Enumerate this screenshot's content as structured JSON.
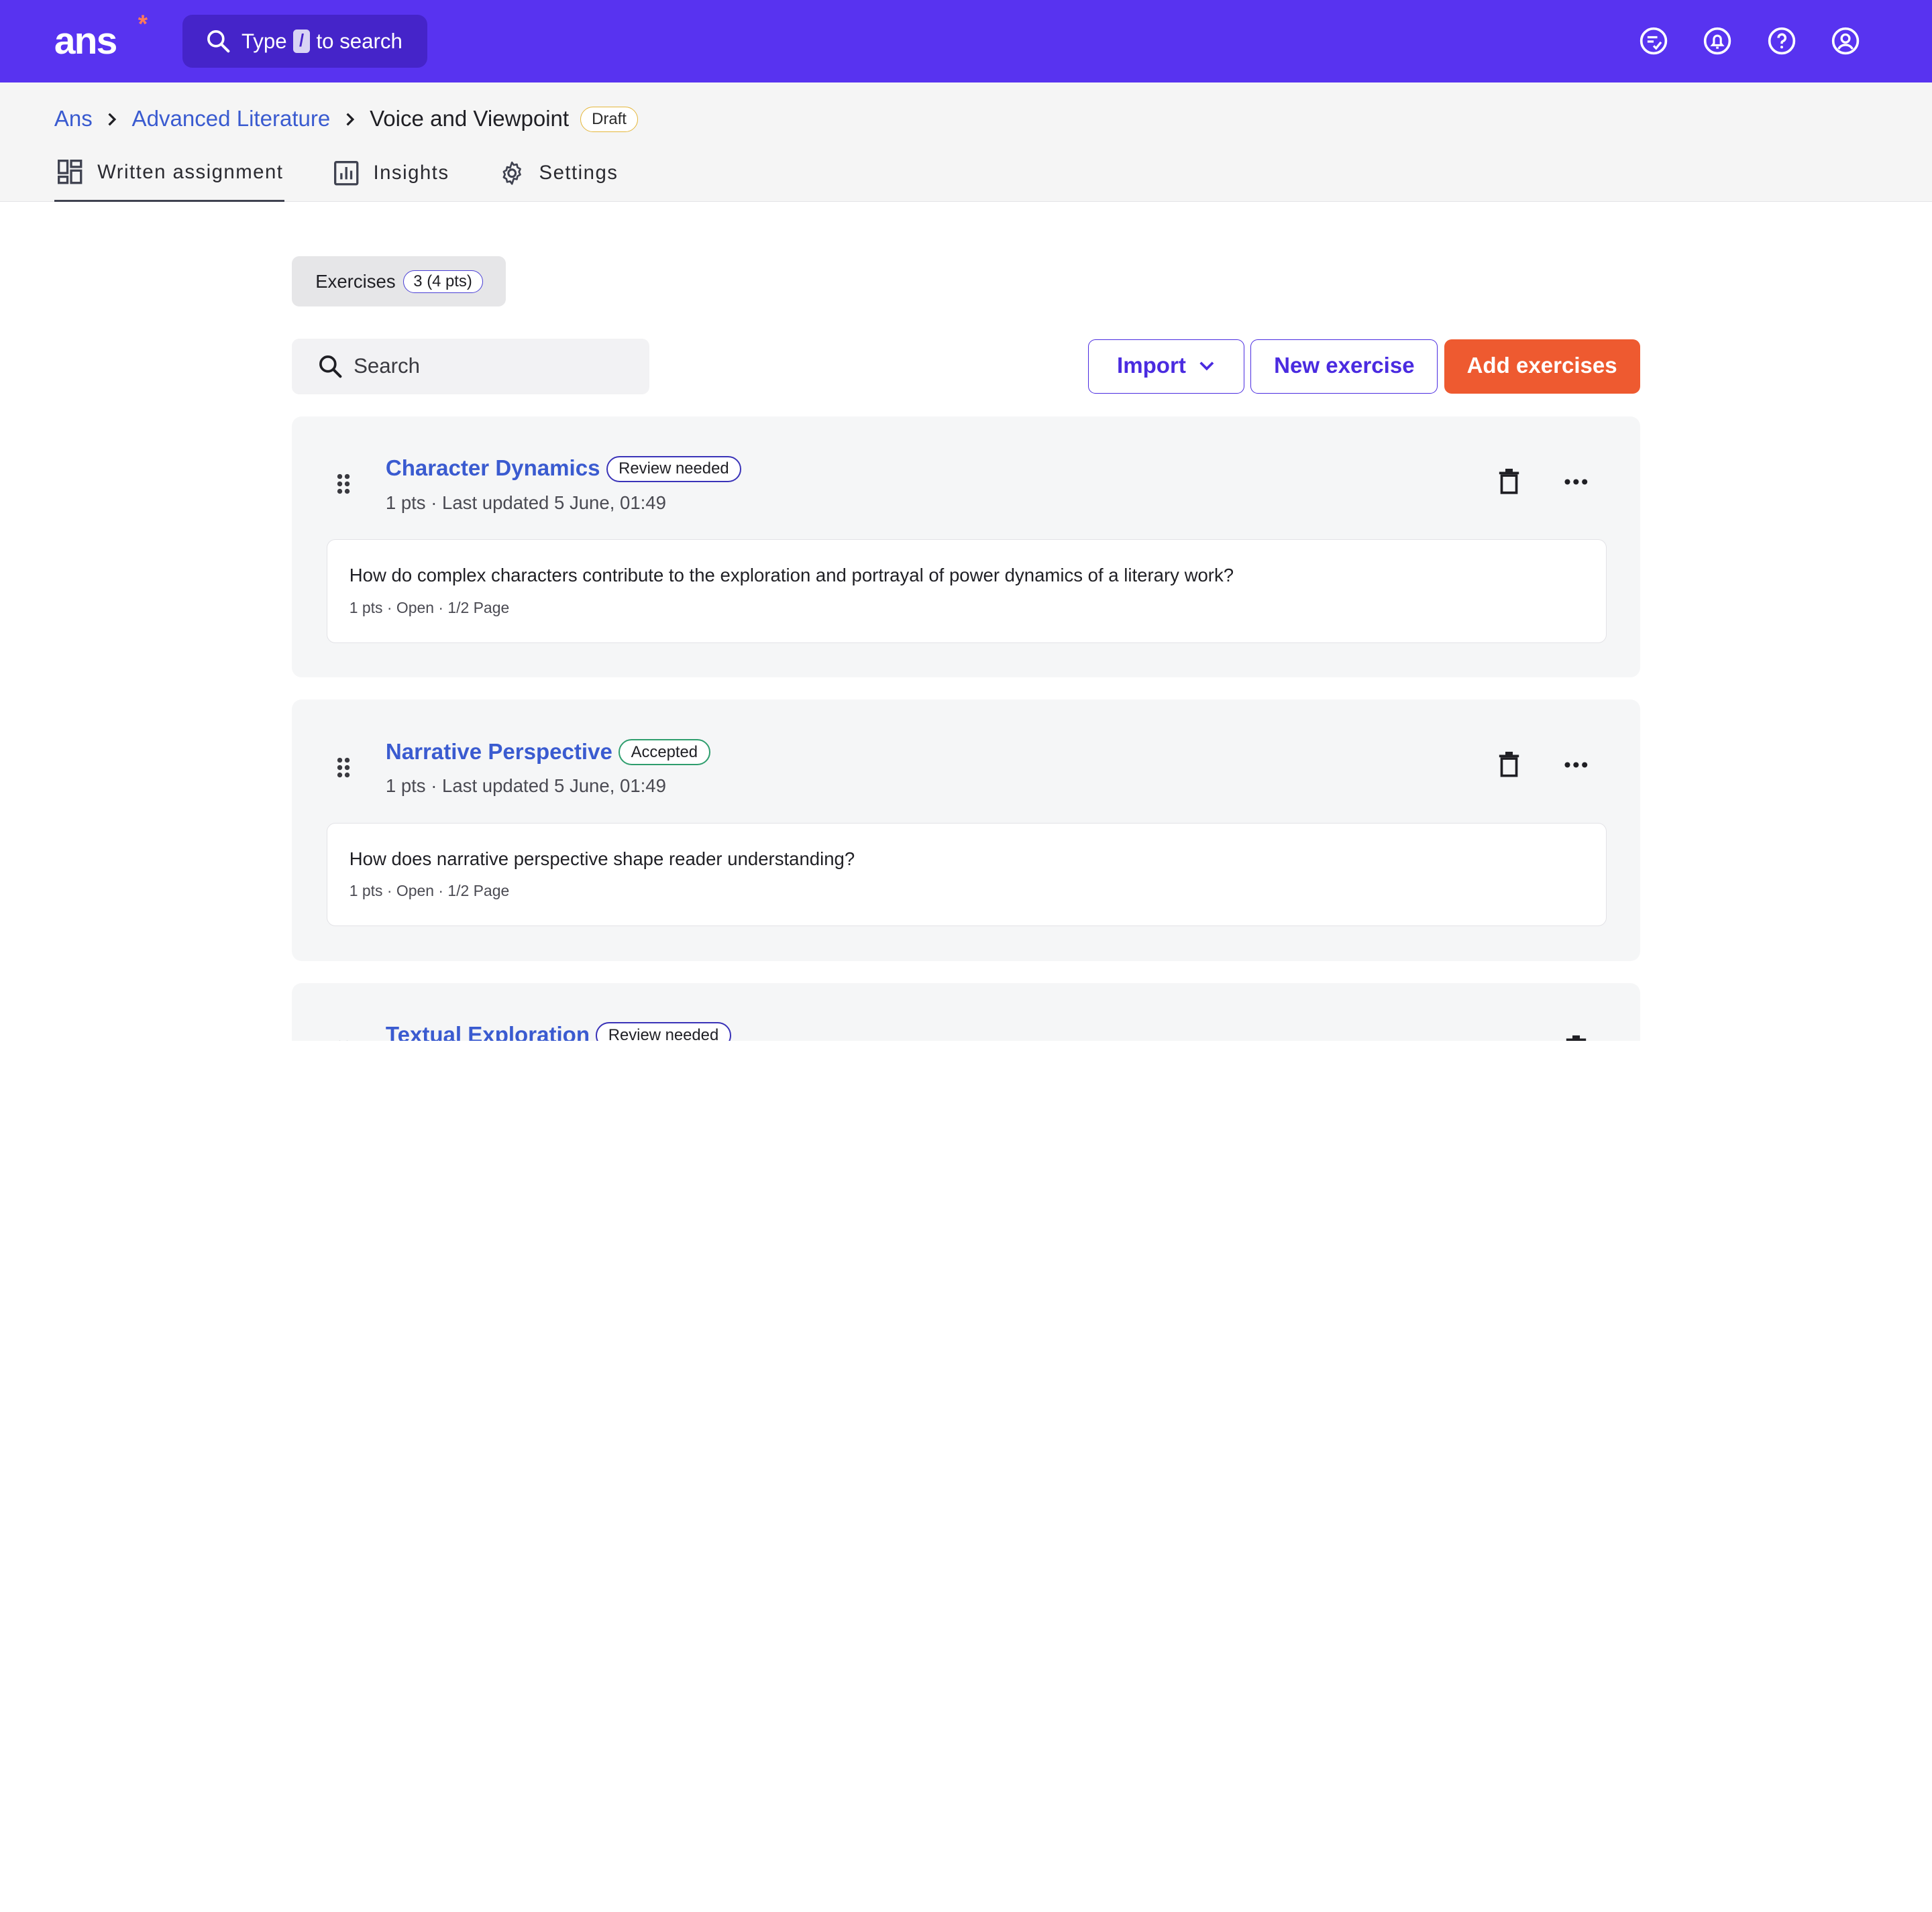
{
  "topbar": {
    "logo": "ans",
    "logo_mark": "*",
    "search": {
      "prefix": "Type",
      "key": "/",
      "suffix": "to search"
    },
    "icons": [
      "tasks-icon",
      "notification-bell-icon",
      "help-icon",
      "account-icon"
    ]
  },
  "breadcrumb": {
    "root": "Ans",
    "course": "Advanced Literature",
    "current": "Voice and Viewpoint",
    "status": "Draft"
  },
  "tabs": [
    {
      "label": "Written assignment",
      "icon": "dashboard-icon",
      "active": true
    },
    {
      "label": "Insights",
      "icon": "chart-icon",
      "active": false
    },
    {
      "label": "Settings",
      "icon": "gear-icon",
      "active": false
    }
  ],
  "exercises_chip": {
    "label": "Exercises",
    "count": "3 (4 pts)"
  },
  "search": {
    "placeholder": "Search"
  },
  "actions": {
    "import": "Import",
    "new_exercise": "New exercise",
    "add_exercises": "Add exercises"
  },
  "colors": {
    "brand": "#5833f0",
    "primary_action": "#ee5a30",
    "link": "#3a5bd0"
  },
  "exercises": [
    {
      "title": "Character Dynamics",
      "status": "Review needed",
      "meta": "1 pts · Last updated 5 June, 01:49",
      "question": "How do complex characters contribute to the exploration and portrayal of power dynamics of a literary work?",
      "question_meta": "1 pts · Open · 1/2 Page"
    },
    {
      "title": "Narrative Perspective",
      "status": "Accepted",
      "meta": "1 pts · Last updated 5 June, 01:49",
      "question": "How does narrative perspective shape reader understanding?",
      "question_meta": "1 pts · Open · 1/2 Page"
    },
    {
      "title": "Textual Exploration",
      "status": "Review needed"
    }
  ]
}
